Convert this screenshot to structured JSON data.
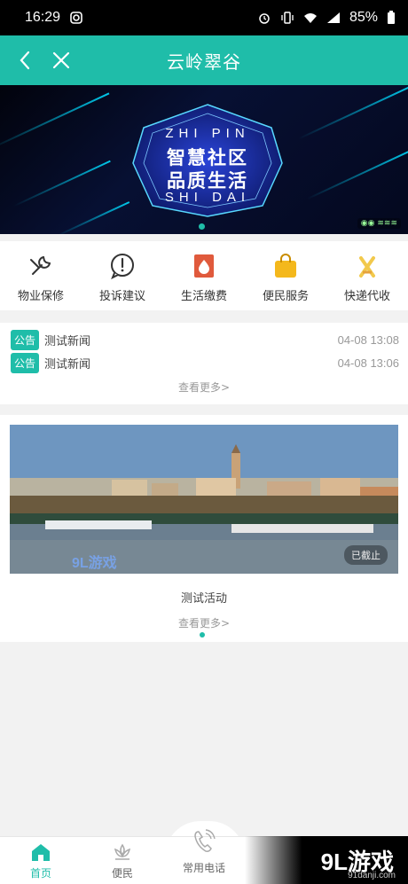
{
  "status_bar": {
    "time": "16:29",
    "battery": "85%"
  },
  "header": {
    "title": "云岭翠谷"
  },
  "banner": {
    "line1": "ZHI PIN",
    "line2": "智慧社区",
    "line3": "品质生活",
    "line4": "SHI DAI"
  },
  "services": [
    {
      "label": "物业保修",
      "icon": "wrench-icon"
    },
    {
      "label": "投诉建议",
      "icon": "exclamation-bubble-icon"
    },
    {
      "label": "生活缴费",
      "icon": "water-drop-icon"
    },
    {
      "label": "便民服务",
      "icon": "shopping-bag-icon"
    },
    {
      "label": "快递代收",
      "icon": "package-icon"
    }
  ],
  "news": {
    "items": [
      {
        "tag": "公告",
        "title": "测试新闻",
        "time": "04-08 13:08"
      },
      {
        "tag": "公告",
        "title": "测试新闻",
        "time": "04-08 13:06"
      }
    ],
    "more": "查看更多>"
  },
  "activity": {
    "image_watermark": "9L游戏",
    "status": "已截止",
    "title": "测试活动",
    "more": "查看更多>"
  },
  "tabbar": {
    "items": [
      {
        "label": "首页",
        "icon": "home-icon",
        "active": true
      },
      {
        "label": "便民",
        "icon": "lotus-icon",
        "active": false
      },
      {
        "label": "常用电话",
        "icon": "phone-icon",
        "active": false
      }
    ]
  },
  "watermark": {
    "brand": "9L游戏",
    "sub": "91danji.com"
  },
  "colors": {
    "accent": "#1fbda9"
  }
}
